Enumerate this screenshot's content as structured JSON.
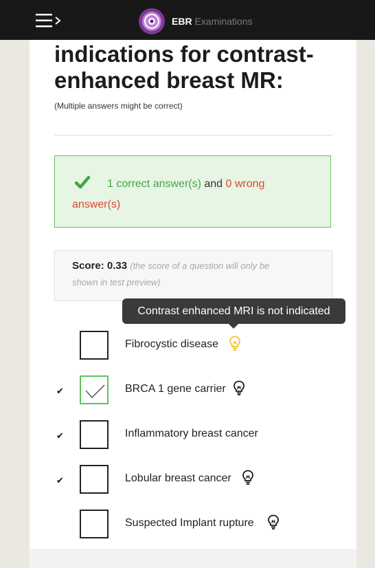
{
  "header": {
    "menu_icon": "menu-arrow-icon",
    "logo_icon": "ebr-logo-icon",
    "brand_bold": "EBR",
    "brand_light": "Examinations"
  },
  "question": {
    "text": "indications for contrast-enhanced breast MR:",
    "hint": "(Multiple answers might be correct)"
  },
  "result": {
    "correct_text": "1 correct answer(s)",
    "and_text": " and ",
    "wrong_text": "0 wrong",
    "answers_text": "answer(s)"
  },
  "score": {
    "label": "Score:",
    "value": "0.33",
    "note_part1": "(the score of a question will only be",
    "note_part2": "shown in test preview)"
  },
  "tooltip": {
    "text": "Contrast enhanced MRI is not indicated"
  },
  "options": [
    {
      "label": "Fibrocystic disease",
      "checked": false,
      "correct": false,
      "bulb": "lightbulb-icon-active"
    },
    {
      "label": "BRCA 1 gene carrier",
      "checked": true,
      "correct": true,
      "bulb": "lightbulb-icon"
    },
    {
      "label": "Inflammatory breast cancer",
      "checked": false,
      "correct": true,
      "bulb": null
    },
    {
      "label": "Lobular breast cancer",
      "checked": false,
      "correct": true,
      "bulb": "lightbulb-icon"
    },
    {
      "label": "Suspected Implant rupture",
      "checked": false,
      "correct": false,
      "bulb": "lightbulb-icon"
    }
  ],
  "tick_glyph": "✔",
  "colors": {
    "correct_green": "#3fa743",
    "wrong_red": "#e2452a",
    "bulb_active": "#f2c12e",
    "checkbox_checked": "#5cc45d"
  }
}
